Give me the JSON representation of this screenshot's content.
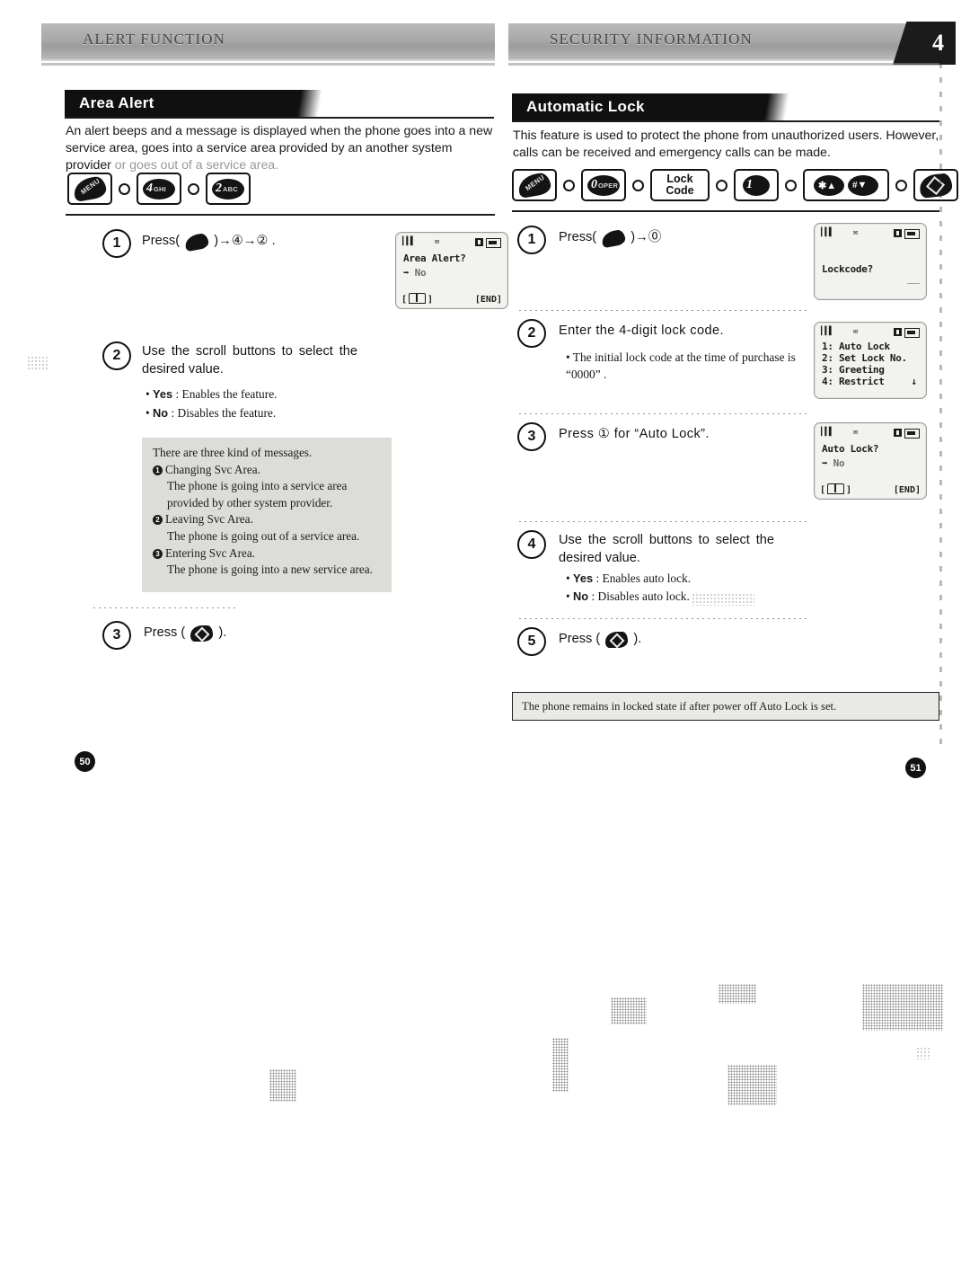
{
  "document": {
    "left_page": {
      "running_head": "ALERT FUNCTION",
      "page_number": "50",
      "section": {
        "title": "Area Alert",
        "intro": "An alert beeps and a message is displayed when the phone goes into a new service area, goes into a service area provided by an another system provider",
        "intro_faded": "or goes out of a service area.",
        "key_sequence": [
          {
            "type": "menu-key",
            "label": "MENU"
          },
          {
            "type": "separator-dot"
          },
          {
            "type": "number-key",
            "digit": "4",
            "letters": "GHI"
          },
          {
            "type": "separator-dot"
          },
          {
            "type": "number-key",
            "digit": "2",
            "letters": "ABC"
          }
        ]
      },
      "steps": [
        {
          "number": "1",
          "text_prefix": "Press(",
          "text_suffix": ")→④→② .",
          "icon": "menu-key-icon"
        },
        {
          "number": "2",
          "text": "Use the scroll buttons to select the desired value.",
          "bullets": [
            {
              "term": "Yes",
              "desc": ": Enables the feature."
            },
            {
              "term": "No",
              "desc": ": Disables the feature."
            }
          ]
        },
        {
          "number": "3",
          "text_prefix": "Press  (",
          "text_suffix": ").",
          "icon": "ok-key-icon"
        }
      ],
      "note_box": {
        "heading": "There are three kind of messages.",
        "items": [
          {
            "badge": "1",
            "title": "Changing Svc Area.",
            "body": "The phone is going into a  service area provided by other system provider."
          },
          {
            "badge": "2",
            "title": "Leaving Svc Area.",
            "body": "The phone is going out of a service area."
          },
          {
            "badge": "3",
            "title": "Entering Svc Area.",
            "body": "The phone is going into a new service area."
          }
        ]
      },
      "lcd": {
        "status": {
          "signal": "signal-bars-icon",
          "mid": "envelope-icon",
          "box": "text-mode-icon",
          "battery": "battery-icon"
        },
        "line1": "Area Alert?",
        "line2_arrow": "➡",
        "line2": "No",
        "soft_left": "book-icon",
        "soft_right": "[END]"
      }
    },
    "right_page": {
      "running_head": "SECURITY INFORMATION",
      "chapter_tab": "4",
      "page_number": "51",
      "section": {
        "title": "Automatic Lock",
        "intro": "This feature is used to protect the phone from unauthorized users. However, calls can be received and emergency calls can be made.",
        "key_sequence": [
          {
            "type": "menu-key",
            "label": "MENU"
          },
          {
            "type": "separator-dot"
          },
          {
            "type": "number-key",
            "digit": "0",
            "letters": "OPER"
          },
          {
            "type": "separator-dot"
          },
          {
            "type": "text-key",
            "line1": "Lock",
            "line2": "Code"
          },
          {
            "type": "separator-dot"
          },
          {
            "type": "number-key",
            "digit": "1",
            "letters": ""
          },
          {
            "type": "separator-dot"
          },
          {
            "type": "double-key",
            "left": "✱▲",
            "right": "#▼"
          },
          {
            "type": "separator-dot"
          },
          {
            "type": "ok-key"
          }
        ]
      },
      "steps": [
        {
          "number": "1",
          "text_prefix": "Press(",
          "text_suffix": ")→⓪",
          "icon": "menu-key-icon"
        },
        {
          "number": "2",
          "text": "Enter the 4-digit lock code.",
          "bullets": [
            {
              "term": "",
              "desc": "The initial lock code at the time of purchase is “0000” ."
            }
          ]
        },
        {
          "number": "3",
          "text": "Press ① for  “Auto Lock”."
        },
        {
          "number": "4",
          "text": "Use the scroll buttons to select the desired value.",
          "bullets": [
            {
              "term": "Yes",
              "desc": ": Enables auto lock."
            },
            {
              "term": "No",
              "desc": ": Disables auto lock."
            }
          ]
        },
        {
          "number": "5",
          "text_prefix": "Press  (",
          "text_suffix": ").",
          "icon": "ok-key-icon"
        }
      ],
      "tip_box": "The phone remains in locked state if after power off Auto Lock is set.",
      "lcds": [
        {
          "id": "lockcode-screen",
          "line1": "Lockcode?",
          "squiggle": "————"
        },
        {
          "id": "security-menu-screen",
          "menu": [
            "1: Auto Lock",
            "2: Set Lock No.",
            "3: Greeting",
            "4: Restrict"
          ],
          "scroll": "↓"
        },
        {
          "id": "auto-lock-screen",
          "line1": "Auto Lock?",
          "line2_arrow": "➡",
          "line2": "No",
          "soft_left": "book-icon",
          "soft_right": "[END]"
        }
      ]
    },
    "colors": {
      "banner": "#101010",
      "runhead": "#a8a8a8",
      "note_box": "#dcdcd8",
      "tip_box": "#e9e9e6",
      "text": "#141414"
    }
  }
}
